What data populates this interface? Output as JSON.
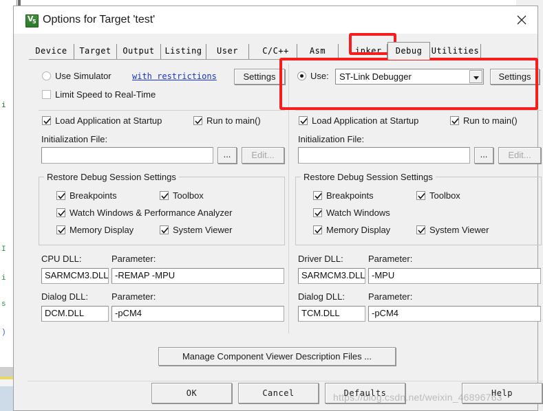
{
  "window": {
    "title": "Options for Target 'test'",
    "icon": "keil-uvision5-icon",
    "icon_text_top": "V",
    "icon_text_bottom": "5",
    "close_icon": "close-icon"
  },
  "tabs": [
    {
      "label": "Device",
      "active": false
    },
    {
      "label": "Target",
      "active": false
    },
    {
      "label": "Output",
      "active": false
    },
    {
      "label": "Listing",
      "active": false
    },
    {
      "label": "User",
      "active": false
    },
    {
      "label": "C/C++",
      "active": false
    },
    {
      "label": "Asm",
      "active": false
    },
    {
      "label": "Linker",
      "active": false
    },
    {
      "label": "Debug",
      "active": true
    },
    {
      "label": "Utilities",
      "active": false
    }
  ],
  "left_pane": {
    "use_simulator": {
      "label": "Use Simulator",
      "checked": false
    },
    "with_restrictions_link": "with restrictions",
    "settings_button": "Settings",
    "limit_speed": {
      "label": "Limit Speed to Real-Time",
      "checked": false
    },
    "load_app_at_startup": {
      "label": "Load Application at Startup",
      "checked": true
    },
    "run_to_main": {
      "label": "Run to main()",
      "checked": true
    },
    "init_file_label": "Initialization File:",
    "init_file_value": "",
    "browse_button": "...",
    "edit_button": "Edit...",
    "restore_group": {
      "title": "Restore Debug Session Settings",
      "items": [
        {
          "label": "Breakpoints",
          "checked": true
        },
        {
          "label": "Toolbox",
          "checked": true
        },
        {
          "label": "Watch Windows & Performance Analyzer",
          "checked": true
        },
        {
          "label": "Memory Display",
          "checked": true
        },
        {
          "label": "System Viewer",
          "checked": true
        }
      ]
    },
    "dll_rows": [
      {
        "name_label": "CPU DLL:",
        "name_value": "SARMCM3.DLL",
        "param_label": "Parameter:",
        "param_value": "-REMAP -MPU"
      },
      {
        "name_label": "Dialog DLL:",
        "name_value": "DCM.DLL",
        "param_label": "Parameter:",
        "param_value": "-pCM4"
      }
    ]
  },
  "right_pane": {
    "use_radio": {
      "label": "Use:",
      "checked": true
    },
    "debugger_select": {
      "value": "ST-Link Debugger",
      "dropdown_icon": "chevron-down-icon"
    },
    "settings_button": "Settings",
    "load_app_at_startup": {
      "label": "Load Application at Startup",
      "checked": true
    },
    "run_to_main": {
      "label": "Run to main()",
      "checked": true
    },
    "init_file_label": "Initialization File:",
    "init_file_value": "",
    "browse_button": "...",
    "edit_button": "Edit...",
    "restore_group": {
      "title": "Restore Debug Session Settings",
      "items": [
        {
          "label": "Breakpoints",
          "checked": true
        },
        {
          "label": "Toolbox",
          "checked": true
        },
        {
          "label": "Watch Windows",
          "checked": true
        },
        {
          "label": "Memory Display",
          "checked": true
        },
        {
          "label": "System Viewer",
          "checked": true
        }
      ]
    },
    "dll_rows": [
      {
        "name_label": "Driver DLL:",
        "name_value": "SARMCM3.DLL",
        "param_label": "Parameter:",
        "param_value": "-MPU"
      },
      {
        "name_label": "Dialog DLL:",
        "name_value": "TCM.DLL",
        "param_label": "Parameter:",
        "param_value": "-pCM4"
      }
    ]
  },
  "manage_button": "Manage Component Viewer Description Files ...",
  "footer_buttons": {
    "ok": "OK",
    "cancel": "Cancel",
    "defaults": "Defaults",
    "help": "Help"
  },
  "annotations": {
    "highlight_color": "#f71d1d",
    "boxes": [
      "debug-tab-highlight",
      "debugger-select-highlight"
    ]
  },
  "watermark": "https://blog.csdn.net/weixin_46896763",
  "background_code_fragments": [
    "i",
    "I",
    "i",
    "s",
    ")"
  ]
}
